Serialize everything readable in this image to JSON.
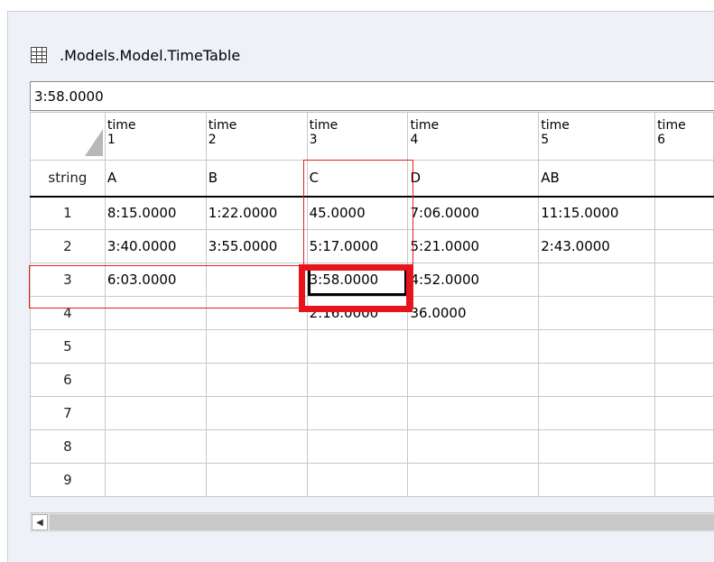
{
  "window": {
    "title": ".Models.Model.TimeTable",
    "icon": "table-grid-icon"
  },
  "formula_bar": {
    "value": "3:58.0000"
  },
  "table": {
    "columns": [
      {
        "line1": "time",
        "line2": "1"
      },
      {
        "line1": "time",
        "line2": "2"
      },
      {
        "line1": "time",
        "line2": "3"
      },
      {
        "line1": "time",
        "line2": "4"
      },
      {
        "line1": "time",
        "line2": "5"
      },
      {
        "line1": "time",
        "line2": "6"
      }
    ],
    "type_row": {
      "header": "string",
      "values": [
        "A",
        "B",
        "C",
        "D",
        "AB",
        ""
      ]
    },
    "rows": [
      {
        "index": "1",
        "cells": [
          "8:15.0000",
          "1:22.0000",
          "45.0000",
          "7:06.0000",
          "11:15.0000",
          ""
        ]
      },
      {
        "index": "2",
        "cells": [
          "3:40.0000",
          "3:55.0000",
          "5:17.0000",
          "5:21.0000",
          "2:43.0000",
          ""
        ]
      },
      {
        "index": "3",
        "cells": [
          "6:03.0000",
          "",
          "3:58.0000",
          "4:52.0000",
          "",
          ""
        ]
      },
      {
        "index": "4",
        "cells": [
          "",
          "",
          "2:16.0000",
          "36.0000",
          "",
          ""
        ]
      },
      {
        "index": "5",
        "cells": [
          "",
          "",
          "",
          "",
          "",
          ""
        ]
      },
      {
        "index": "6",
        "cells": [
          "",
          "",
          "",
          "",
          "",
          ""
        ]
      },
      {
        "index": "7",
        "cells": [
          "",
          "",
          "",
          "",
          "",
          ""
        ]
      },
      {
        "index": "8",
        "cells": [
          "",
          "",
          "",
          "",
          "",
          ""
        ]
      },
      {
        "index": "9",
        "cells": [
          "",
          "",
          "",
          "",
          "",
          ""
        ]
      }
    ]
  },
  "scrollbar": {
    "left_arrow_icon": "scroll-left-arrow-icon",
    "left_arrow_glyph": "◀"
  },
  "colors": {
    "annotation_red": "#e8141c",
    "window_background": "#eef1f7"
  }
}
